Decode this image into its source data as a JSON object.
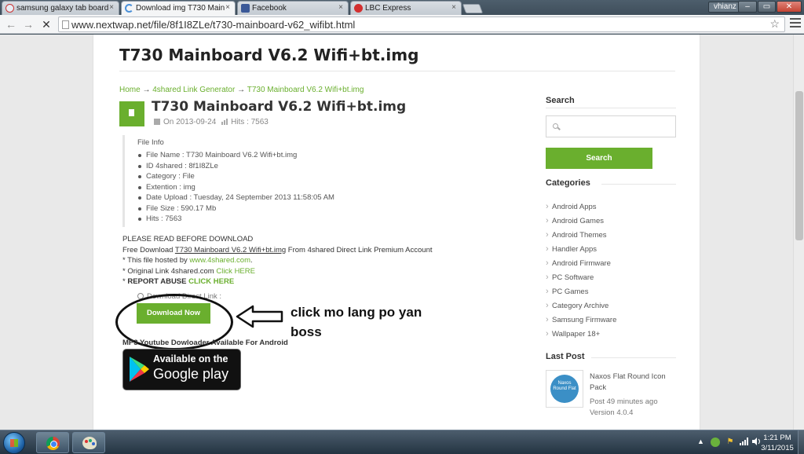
{
  "browser": {
    "tabs": [
      {
        "label": "samsung galaxy tab board",
        "active": false
      },
      {
        "label": "Download img T730 Main",
        "active": true
      },
      {
        "label": "Facebook",
        "active": false
      },
      {
        "label": "LBC Express",
        "active": false
      }
    ],
    "close_glyph": "×",
    "window_user": "vhianz",
    "window_buttons": {
      "minimize": "–",
      "maximize": "▭",
      "close": "✕"
    },
    "url": "www.nextwap.net/file/8f1I8ZLe/t730-mainboard-v62_wifibt.html",
    "nav": {
      "back": "←",
      "forward": "→",
      "stop": "✕"
    },
    "star_glyph": "☆"
  },
  "page": {
    "title": "T730 Mainboard V6.2 Wifi+bt.img",
    "breadcrumb": {
      "home": "Home",
      "sep": " → ",
      "generator": "4shared Link Generator",
      "current": "T730 Mainboard V6.2 Wifi+bt.img"
    },
    "post_title": "T730 Mainboard V6.2 Wifi+bt.img",
    "meta": {
      "date": "On 2013-09-24",
      "hits": "Hits : 7563"
    },
    "file_info": {
      "heading": "File Info",
      "items": [
        "File Name : T730 Mainboard V6.2 Wifi+bt.img",
        "ID 4shared : 8f1I8ZLe",
        "Category : File",
        "Extention : img",
        "Date Upload : Tuesday, 24 September 2013 11:58:05 AM",
        "File Size : 590.17 Mb",
        "Hits : 7563"
      ]
    },
    "notice": {
      "line1": "PLEASE READ BEFORE DOWNLOAD",
      "line2_pre": "Free Download ",
      "line2_link": "T730 Mainboard V6.2 Wifi+bt.img",
      "line2_post": " From 4shared Direct Link Premium Account",
      "line3_pre": "* This file hosted by ",
      "line3_link": "www.4shared.com",
      "line3_post": ".",
      "line4_pre": "* Original Link 4shared.com ",
      "line4_link": "Click HERE",
      "line5_pre": "* ",
      "line5_bold": "REPORT ABUSE",
      "line5_sep": " ",
      "line5_link": "CLICK HERE"
    },
    "download_direct_label": "Download Direct Link :",
    "download_button": "Download Now",
    "annotation": {
      "line1": "click mo lang po yan",
      "line2": "boss"
    },
    "mp3_text": "MP3 Youtube Dowloader Available For Android",
    "google_play": {
      "line1": "Available on the",
      "line2": "Google play"
    }
  },
  "sidebar": {
    "search_heading": "Search",
    "search_placeholder": "",
    "search_button": "Search",
    "categories_heading": "Categories",
    "categories": [
      "Android Apps",
      "Android Games",
      "Android Themes",
      "Handler Apps",
      "Android Firmware",
      "PC Software",
      "PC Games",
      "Category Archive",
      "Samsung Firmware",
      "Wallpaper 18+"
    ],
    "last_post_heading": "Last Post",
    "last_post": {
      "thumb_text": "Naxos Round Flat",
      "title": "Naxos Flat Round Icon Pack",
      "time": "Post 49 minutes ago",
      "version": "Version 4.0.4"
    }
  },
  "taskbar": {
    "time": "1:21 PM",
    "date": "3/11/2015",
    "tray_up": "▲"
  },
  "colors": {
    "accent_green": "#6aaf2e",
    "link_green": "#6aaf2e",
    "taskbar": "#2c3e50"
  }
}
